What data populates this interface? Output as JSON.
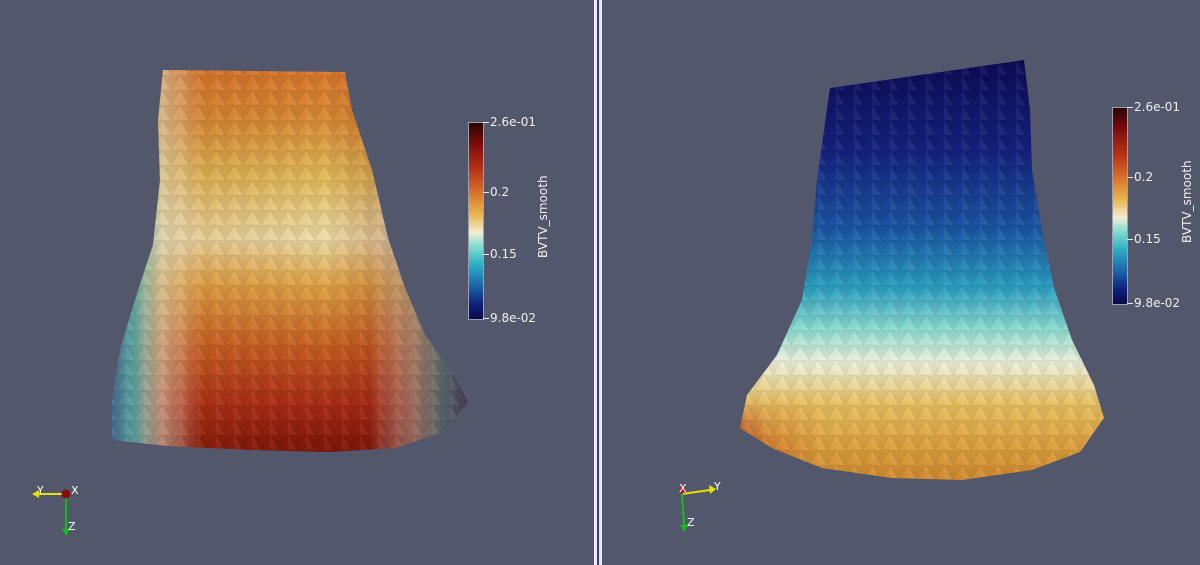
{
  "views": [
    {
      "legend": {
        "title": "BVTV_smooth",
        "labels": [
          "2.6e-01",
          "0.2",
          "0.15",
          "9.8e-02"
        ]
      },
      "axes": {
        "h": "Y",
        "d": "X",
        "v": "Z"
      }
    },
    {
      "legend": {
        "title": "BVTV_smooth",
        "labels": [
          "2.6e-01",
          "0.2",
          "0.15",
          "9.8e-02"
        ]
      },
      "axes": {
        "h": "Y",
        "d": "X",
        "v": "Z"
      }
    }
  ],
  "colors": {
    "background": "#52576b",
    "splitter": "#ececf2",
    "splitter_line": "#2f3aa8",
    "axis_x": "#d01010",
    "axis_y": "#e8e000",
    "axis_z": "#10c010"
  }
}
